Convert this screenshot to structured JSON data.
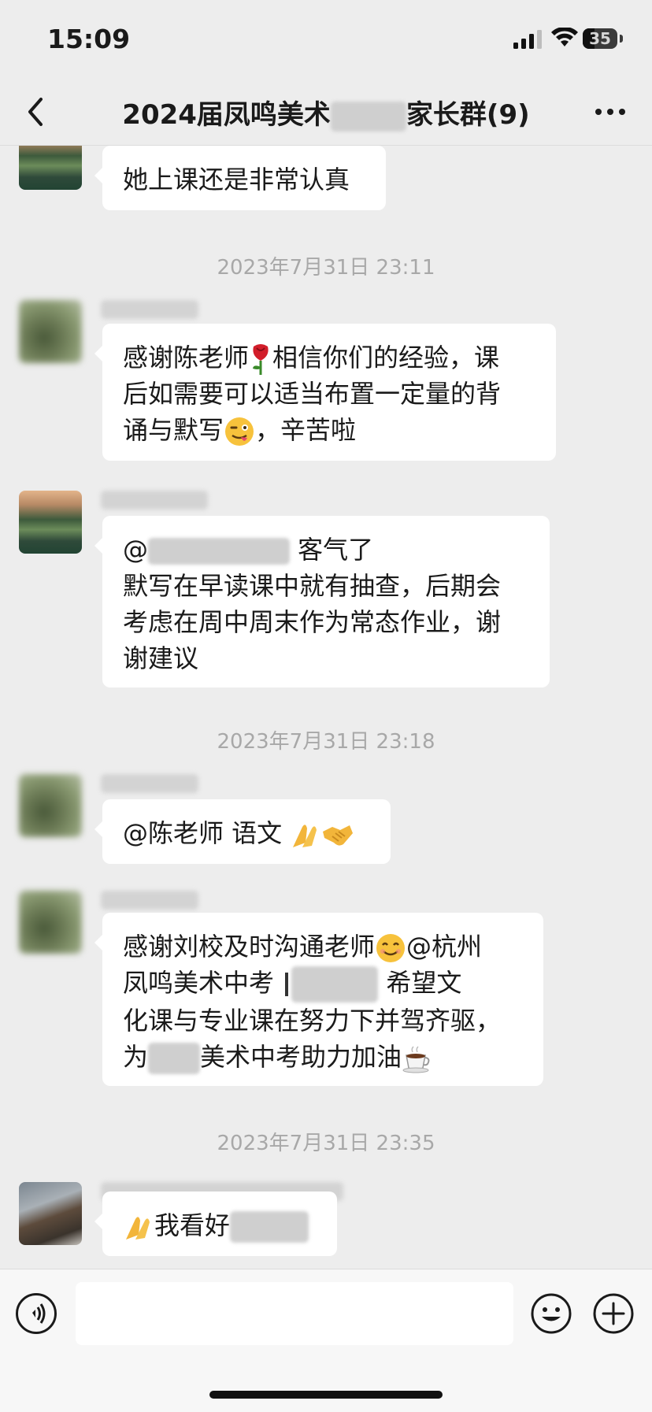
{
  "status_bar": {
    "time": "15:09",
    "battery": "35",
    "battery_level": 0.35
  },
  "nav": {
    "title_prefix": "2024届凤鸣美术",
    "title_suffix": "家长群(9)"
  },
  "messages": [
    {
      "type": "text",
      "avatar": "castle",
      "text": "她上课还是非常认真"
    },
    {
      "type": "timestamp",
      "text": "2023年7月31日 23:11"
    },
    {
      "type": "text",
      "avatar": "blurred",
      "line1a": "感谢陈老师",
      "line1b": "相信你们的经验，课",
      "line2": "后如需要可以适当布置一定量的背",
      "line3a": "诵与默写",
      "line3b": "，辛苦啦",
      "emoji_a": "rose",
      "emoji_b": "winking-tongue"
    },
    {
      "type": "text",
      "avatar": "castle",
      "line1a": "@",
      "line1b": "客气了",
      "line2": "默写在早读课中就有抽查，后期会",
      "line3": "考虑在周中周末作为常态作业，谢",
      "line4": "谢建议"
    },
    {
      "type": "timestamp",
      "text": "2023年7月31日 23:18"
    },
    {
      "type": "text",
      "avatar": "blurred",
      "text": "@陈老师  语文 ",
      "emoji_a": "pray",
      "emoji_b": "handshake"
    },
    {
      "type": "text",
      "avatar": "blurred",
      "line1a": "感谢刘校及时沟通老师",
      "line1b": "@杭州",
      "line2a": "凤鸣美术中考 ",
      "line2b": " 希望文",
      "line3": "化课与专业课在努力下并驾齐驱，",
      "line4a": "为",
      "line4b": "美术中考助力加油",
      "emoji_a": "smile",
      "emoji_b": "coffee"
    },
    {
      "type": "timestamp",
      "text": "2023年7月31日 23:35"
    },
    {
      "type": "text",
      "avatar": "person",
      "text": "我看好",
      "emoji_a": "pray"
    }
  ]
}
